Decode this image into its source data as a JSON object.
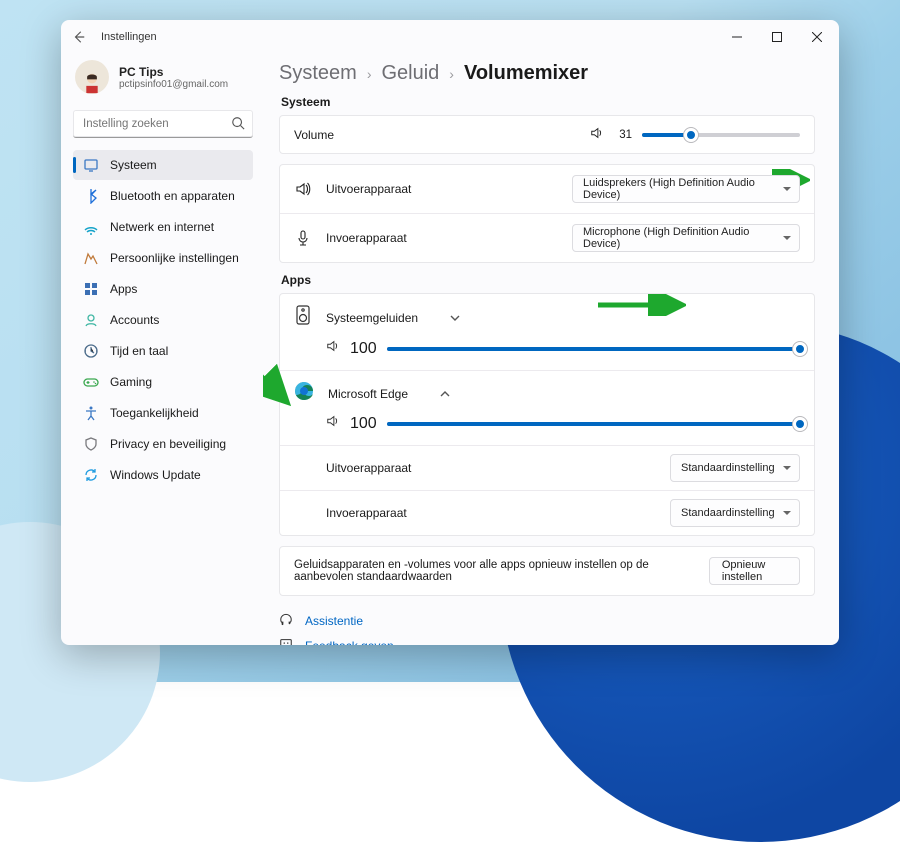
{
  "window": {
    "title": "Instellingen"
  },
  "profile": {
    "name": "PC Tips",
    "email": "pctipsinfo01@gmail.com"
  },
  "search": {
    "placeholder": "Instelling zoeken"
  },
  "nav": [
    {
      "id": "systeem",
      "label": "Systeem",
      "color": "#3b78c4",
      "active": true
    },
    {
      "id": "bluetooth",
      "label": "Bluetooth en apparaten",
      "color": "#1e6fd9"
    },
    {
      "id": "netwerk",
      "label": "Netwerk en internet",
      "color": "#16a3c9"
    },
    {
      "id": "persoon",
      "label": "Persoonlijke instellingen",
      "color": "#c07a3b"
    },
    {
      "id": "apps",
      "label": "Apps",
      "color": "#3b6fb4"
    },
    {
      "id": "accounts",
      "label": "Accounts",
      "color": "#3fb6a3"
    },
    {
      "id": "tijd",
      "label": "Tijd en taal",
      "color": "#4b6b8a"
    },
    {
      "id": "gaming",
      "label": "Gaming",
      "color": "#3aa84f"
    },
    {
      "id": "toegang",
      "label": "Toegankelijkheid",
      "color": "#3b78c4"
    },
    {
      "id": "privacy",
      "label": "Privacy en beveiliging",
      "color": "#7a7a7e"
    },
    {
      "id": "update",
      "label": "Windows Update",
      "color": "#1e9be0"
    }
  ],
  "breadcrumb": {
    "a": "Systeem",
    "b": "Geluid",
    "c": "Volumemixer"
  },
  "section_system": "Systeem",
  "system": {
    "volume_label": "Volume",
    "volume_value": 31,
    "output_label": "Uitvoerapparaat",
    "output_device": "Luidsprekers (High Definition Audio Device)",
    "input_label": "Invoerapparaat",
    "input_device": "Microphone (High Definition Audio Device)"
  },
  "section_apps": "Apps",
  "apps": [
    {
      "name": "Systeemgeluiden",
      "volume": 100,
      "expanded": false
    },
    {
      "name": "Microsoft Edge",
      "volume": 100,
      "expanded": true,
      "output_label": "Uitvoerapparaat",
      "output_value": "Standaardinstelling",
      "input_label": "Invoerapparaat",
      "input_value": "Standaardinstelling"
    }
  ],
  "reset": {
    "text": "Geluidsapparaten en -volumes voor alle apps opnieuw instellen op de aanbevolen standaardwaarden",
    "button": "Opnieuw instellen"
  },
  "links": {
    "assist": "Assistentie",
    "feedback": "Feedback geven"
  }
}
